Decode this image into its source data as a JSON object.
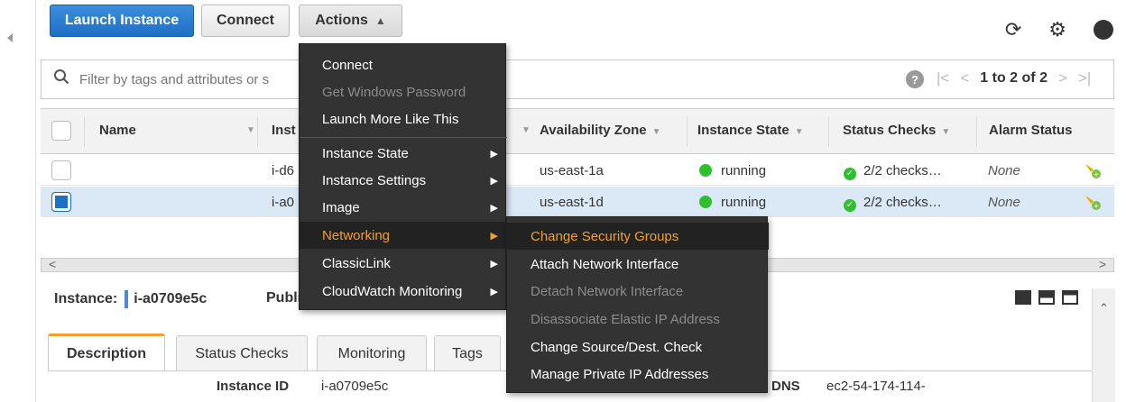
{
  "toolbar": {
    "launch_label": "Launch Instance",
    "connect_label": "Connect",
    "actions_label": "Actions",
    "icons": [
      "refresh-icon",
      "gear-icon",
      "help-icon"
    ]
  },
  "filter": {
    "placeholder": "Filter by tags and attributes or s",
    "help": "?",
    "pager_text": "1 to 2 of 2"
  },
  "grid": {
    "columns": [
      "Name",
      "Inst",
      "Availability Zone",
      "Instance State",
      "Status Checks",
      "Alarm Status"
    ],
    "rows": [
      {
        "id_partial": "i-d6",
        "zone": "us-east-1a",
        "state": "running",
        "checks": "2/2 checks…",
        "alarm": "None",
        "selected": false
      },
      {
        "id_partial": "i-a0",
        "zone": "us-east-1d",
        "state": "running",
        "checks": "2/2 checks…",
        "alarm": "None",
        "selected": true
      }
    ]
  },
  "detail": {
    "instance_label": "Instance:",
    "instance_id": "i-a0709e5c",
    "public_label": "Publi",
    "tabs": [
      "Description",
      "Status Checks",
      "Monitoring",
      "Tags"
    ],
    "fields": {
      "instance_id_label": "Instance ID",
      "instance_id_value": "i-a0709e5c",
      "dns_label": "DNS",
      "dns_value": "ec2-54-174-114-"
    }
  },
  "actions_menu": {
    "items": [
      {
        "label": "Connect",
        "disabled": false
      },
      {
        "label": "Get Windows Password",
        "disabled": true
      },
      {
        "label": "Launch More Like This",
        "disabled": false
      },
      {
        "label": "Instance State",
        "submenu": true
      },
      {
        "label": "Instance Settings",
        "submenu": true
      },
      {
        "label": "Image",
        "submenu": true
      },
      {
        "label": "Networking",
        "submenu": true,
        "active": true
      },
      {
        "label": "ClassicLink",
        "submenu": true
      },
      {
        "label": "CloudWatch Monitoring",
        "submenu": true
      }
    ]
  },
  "networking_submenu": {
    "items": [
      {
        "label": "Change Security Groups",
        "active": true
      },
      {
        "label": "Attach Network Interface",
        "disabled": false
      },
      {
        "label": "Detach Network Interface",
        "disabled": true
      },
      {
        "label": "Disassociate Elastic IP Address",
        "disabled": true
      },
      {
        "label": "Change Source/Dest. Check",
        "disabled": false
      },
      {
        "label": "Manage Private IP Addresses",
        "disabled": false
      }
    ]
  },
  "colors": {
    "primary": "#1f6fc4",
    "menu_bg": "#333333",
    "menu_active": "#f0a030",
    "running": "#2fbf2f"
  }
}
